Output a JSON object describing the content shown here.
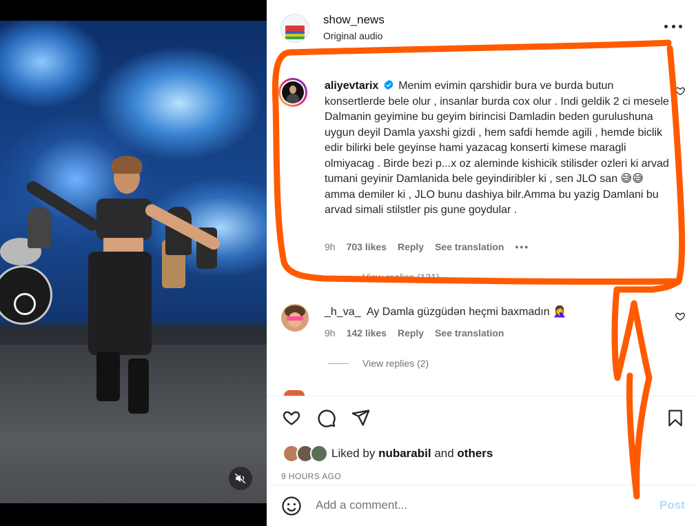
{
  "post": {
    "username": "show_news",
    "audio": "Original audio"
  },
  "comments": [
    {
      "username": "aliyevtarix",
      "verified": true,
      "text": "Menim evimin qarshidir bura ve burda butun konsertlerde bele olur , insanlar burda cox olur . Indi geldik 2 ci mesele Dalmanin geyimine bu geyim birincisi Damladin beden gurulushuna uygun deyil Damla yaxshi gizdi , hem safdi hemde agili , hemde biclik edir bilirki bele geyinse hami yazacag konserti kimese maragli olmiyacag . Birde bezi p...x oz aleminde kishicik stilisder ozleri ki arvad tumani geyinir Damlanida bele geyindiribler ki , sen JLO san 😅😅 amma demiler ki , JLO bunu dashiya bilr.Amma bu yazig Damlani bu arvad simali stilstler pis gune goydular .",
      "time": "9h",
      "likes": "703 likes",
      "reply": "Reply",
      "translate": "See translation",
      "view_replies": "View replies (131)"
    },
    {
      "username": "_h_va_",
      "verified": false,
      "text": "Ay Damla güzgüdən heçmi baxmadın 🤦‍♀️",
      "time": "9h",
      "likes": "142 likes",
      "reply": "Reply",
      "translate": "See translation",
      "view_replies": "View replies (2)"
    }
  ],
  "footer": {
    "liked_prefix": "Liked by",
    "liked_user": "nubarabil",
    "liked_and": "and",
    "liked_others": "others",
    "timestamp": "9 HOURS AGO",
    "comment_placeholder": "Add a comment...",
    "post_label": "Post"
  },
  "colors": {
    "annotation": "#ff5a00",
    "verified": "#0095f6",
    "post_disabled": "#b3dbff"
  }
}
